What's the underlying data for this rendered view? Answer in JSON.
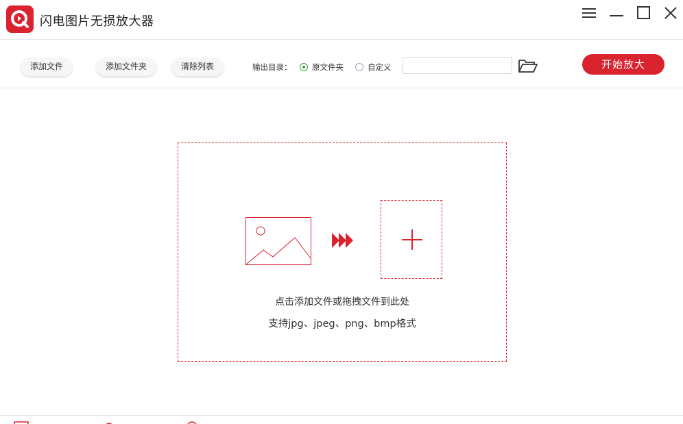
{
  "app": {
    "title": "闪电图片无损放大器",
    "accent_color": "#d9232e"
  },
  "window_controls": {
    "menu_icon": "hamburger-menu-icon",
    "minimize_icon": "minimize-icon",
    "maximize_icon": "maximize-icon",
    "close_icon": "close-icon"
  },
  "toolbar": {
    "add_file_label": "添加文件",
    "add_folder_label": "添加文件夹",
    "clear_list_label": "清除列表",
    "output_dir_label": "输出目录：",
    "radio_original": "原文件夹",
    "radio_custom": "自定义",
    "selected_radio": "原文件夹",
    "custom_path_value": "",
    "folder_icon": "folder-open-icon",
    "start_label": "开始放大"
  },
  "dropzone": {
    "image_icon": "image-icon",
    "arrow_icon": "triple-arrow-icon",
    "plus_icon": "plus-icon",
    "hint_line1": "点击添加文件或拖拽文件到此处",
    "hint_line2": "支持jpg、jpeg、png、bmp格式"
  }
}
